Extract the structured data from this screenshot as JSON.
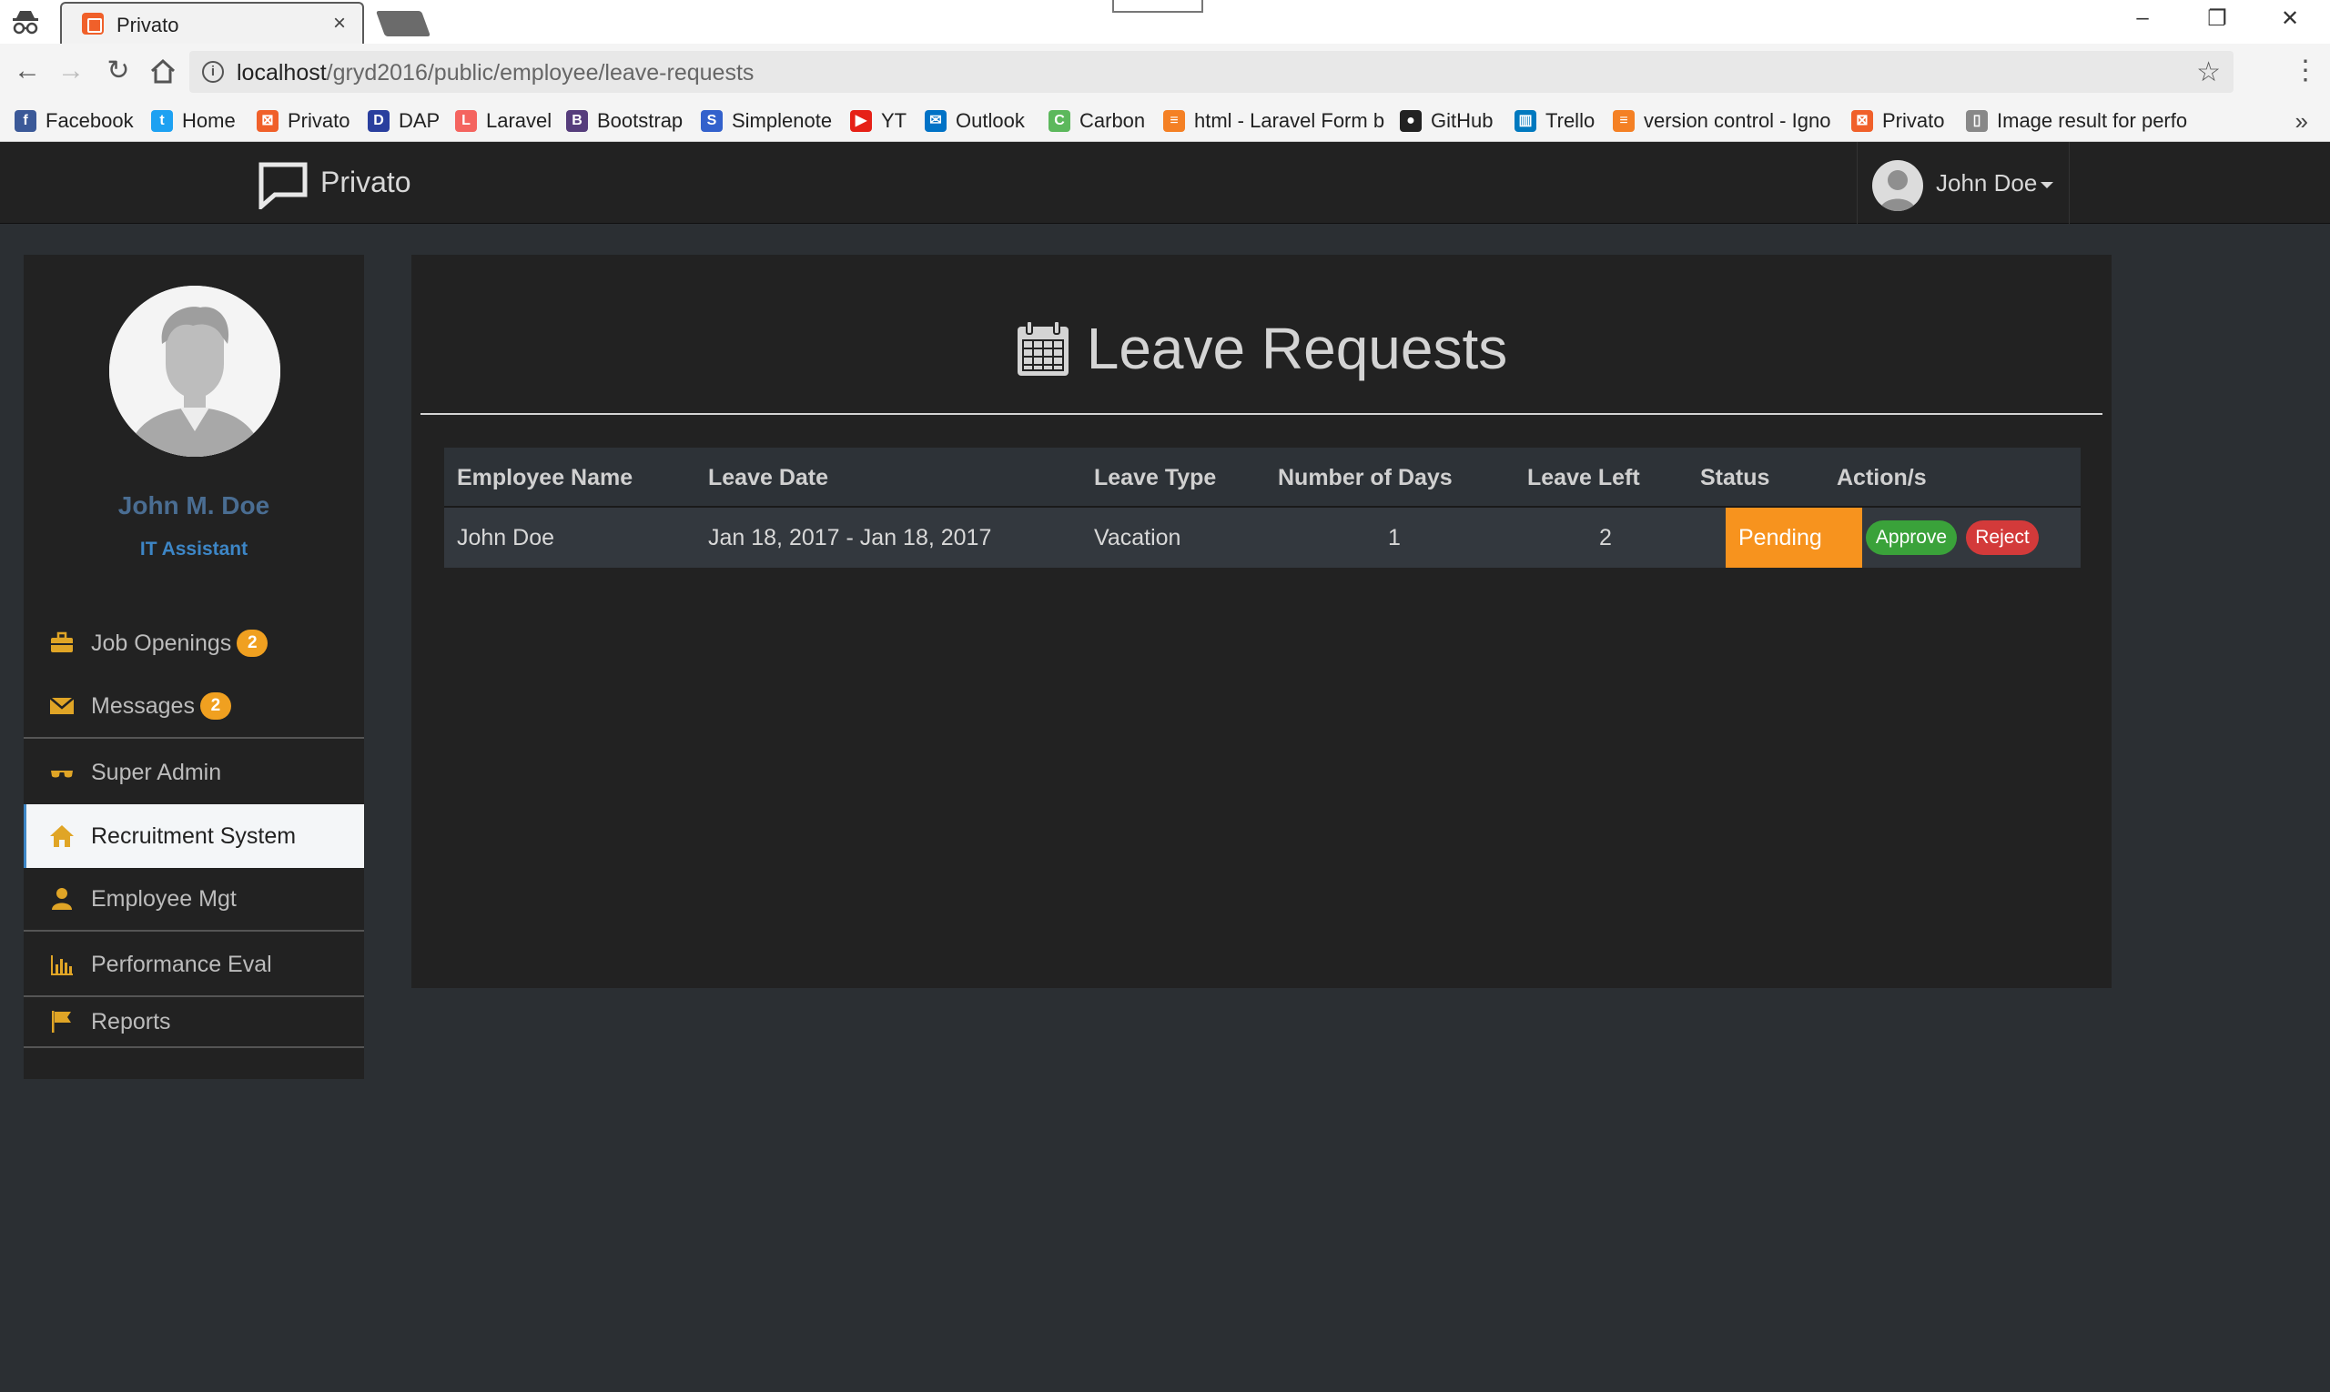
{
  "browser": {
    "tab_title": "Privato",
    "tab_close": "×",
    "url_host": "localhost",
    "url_path": "/gryd2016/public/employee/leave-requests",
    "bookmarks": [
      {
        "label": "Facebook",
        "icon": "facebook-icon",
        "color": "#3b5998"
      },
      {
        "label": "Home",
        "icon": "twitter-icon",
        "color": "#1da1f2"
      },
      {
        "label": "Privato",
        "icon": "xampp-icon",
        "color": "#f0602a"
      },
      {
        "label": "DAP",
        "icon": "dap-icon",
        "color": "#2a3f9e"
      },
      {
        "label": "Laravel",
        "icon": "laravel-icon",
        "color": "#f4645f"
      },
      {
        "label": "Bootstrap",
        "icon": "bootstrap-icon",
        "color": "#563d7c"
      },
      {
        "label": "Simplenote",
        "icon": "simplenote-icon",
        "color": "#3361cc"
      },
      {
        "label": "YT",
        "icon": "youtube-icon",
        "color": "#e62117"
      },
      {
        "label": "Outlook",
        "icon": "outlook-icon",
        "color": "#0072c6"
      },
      {
        "label": "Carbon",
        "icon": "carbon-icon",
        "color": "#5cb85c"
      },
      {
        "label": "html - Laravel Form b",
        "icon": "stackoverflow-icon",
        "color": "#f48024"
      },
      {
        "label": "GitHub",
        "icon": "github-icon",
        "color": "#222222"
      },
      {
        "label": "Trello",
        "icon": "trello-icon",
        "color": "#0079bf"
      },
      {
        "label": "version control - Igno",
        "icon": "stackoverflow-icon",
        "color": "#f48024"
      },
      {
        "label": "Privato",
        "icon": "xampp-icon",
        "color": "#f0602a"
      },
      {
        "label": "Image result for perfo",
        "icon": "page-icon",
        "color": "#888888"
      }
    ],
    "bookmarks_more": "»"
  },
  "navbar": {
    "brand": "Privato",
    "user_name": "John Doe"
  },
  "sidebar": {
    "profile_name": "John M. Doe",
    "profile_role": "IT Assistant",
    "items": [
      {
        "label": "Job Openings",
        "badge": "2",
        "icon": "briefcase-icon"
      },
      {
        "label": "Messages",
        "badge": "2",
        "icon": "envelope-icon"
      },
      {
        "label": "Super Admin",
        "icon": "sunglasses-icon"
      },
      {
        "label": "Recruitment System",
        "icon": "home-icon",
        "active": true
      },
      {
        "label": "Employee Mgt",
        "icon": "user-icon"
      },
      {
        "label": "Performance Eval",
        "icon": "stats-icon"
      },
      {
        "label": "Reports",
        "icon": "flag-icon"
      }
    ]
  },
  "main": {
    "title": "Leave Requests",
    "table": {
      "headers": [
        "Employee Name",
        "Leave Date",
        "Leave Type",
        "Number of Days",
        "Leave Left",
        "Status",
        "Action/s"
      ],
      "rows": [
        {
          "employee_name": "John Doe",
          "leave_date": "Jan 18, 2017 - Jan 18, 2017",
          "leave_type": "Vacation",
          "number_of_days": "1",
          "leave_left": "2",
          "status": "Pending",
          "approve_label": "Approve",
          "reject_label": "Reject"
        }
      ]
    }
  },
  "colors": {
    "accent": "#f0a020",
    "status_pending": "#f7931e",
    "approve": "#3aa23a",
    "reject": "#d33a3a",
    "profile_name": "#4a6d92"
  }
}
